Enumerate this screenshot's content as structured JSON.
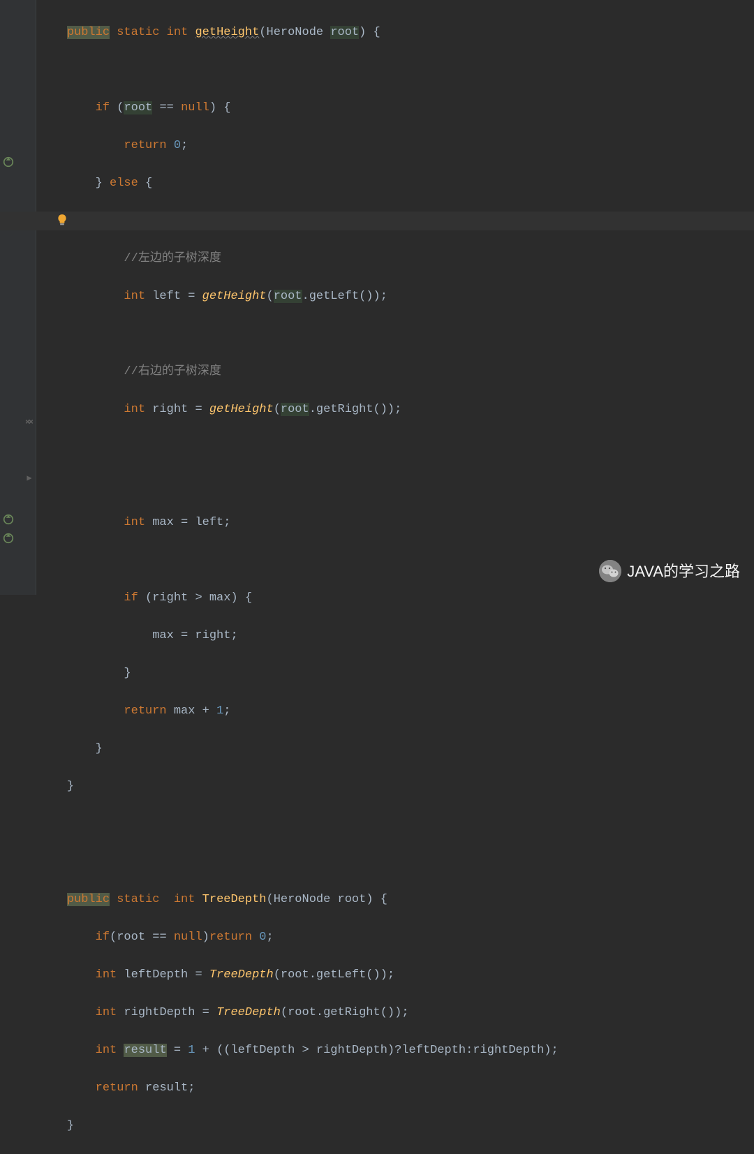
{
  "code": {
    "l1": {
      "pre": "    ",
      "public": "public",
      "sp1": " ",
      "static": "static",
      "sp2": " ",
      "int": "int",
      "sp3": " ",
      "method": "getHeight",
      "lp": "(",
      "ptype": "HeroNode",
      "sp4": " ",
      "pname": "root",
      "rp": ") {"
    },
    "l2": "",
    "l3": {
      "pre": "        ",
      "kw": "if",
      "sp": " (",
      "v": "root",
      "op": " == ",
      "nul": "null",
      "end": ") {"
    },
    "l4": {
      "pre": "            ",
      "kw": "return",
      "sp": " ",
      "num": "0",
      "end": ";"
    },
    "l5": {
      "pre": "        } ",
      "kw": "else",
      "end": " {"
    },
    "l6": "",
    "l7": {
      "pre": "            ",
      "c": "//左边的子树深度"
    },
    "l8": {
      "pre": "            ",
      "t": "int",
      "sp": " left = ",
      "m": "getHeight",
      "lp": "(",
      "v": "root",
      "dot": ".getLeft());"
    },
    "l9": "",
    "l10": {
      "pre": "            ",
      "c": "//右边的子树深度"
    },
    "l11": {
      "pre": "            ",
      "t": "int",
      "sp": " right = ",
      "m": "getHeight",
      "lp": "(",
      "v": "root",
      "dot": ".getRight());"
    },
    "l12": "",
    "l13": "",
    "l14": {
      "pre": "            ",
      "t": "int",
      "sp": " max = left;"
    },
    "l15": "",
    "l16": {
      "pre": "            ",
      "kw": "if",
      "end": " (right > max) {"
    },
    "l17": {
      "pre": "                max = right;"
    },
    "l18": {
      "pre": "            }"
    },
    "l19": {
      "pre": "            ",
      "kw": "return",
      "sp": " max + ",
      "num": "1",
      "end": ";"
    },
    "l20": {
      "pre": "        }"
    },
    "l21": {
      "pre": "    }"
    },
    "l22": "",
    "l23": "",
    "l24": {
      "pre": "    ",
      "public": "public",
      "sp1": " ",
      "static": "static",
      "sp2": "  ",
      "int": "int",
      "sp3": " ",
      "method": "TreeDepth",
      "lp": "(HeroNode root) {"
    },
    "l25": {
      "pre": "        ",
      "kw1": "if",
      "mid": "(root == ",
      "nul": "null",
      "rp": ")",
      "kw2": "return",
      "sp": " ",
      "num": "0",
      "end": ";"
    },
    "l26": {
      "pre": "        ",
      "t": "int",
      "sp": " leftDepth = ",
      "m": "TreeDepth",
      "end": "(root.getLeft());"
    },
    "l27": {
      "pre": "        ",
      "t": "int",
      "sp": " rightDepth = ",
      "m": "TreeDepth",
      "end": "(root.getRight());"
    },
    "l28": {
      "pre": "        ",
      "t": "int",
      "sp": " ",
      "v": "result",
      "eq": " = ",
      "num": "1",
      "end": " + ((leftDepth > rightDepth)?leftDepth:rightDepth);"
    },
    "l29": {
      "pre": "        ",
      "kw": "return",
      "end": " result;"
    },
    "l30": {
      "pre": "    }"
    }
  },
  "watermark": "JAVA的学习之路"
}
